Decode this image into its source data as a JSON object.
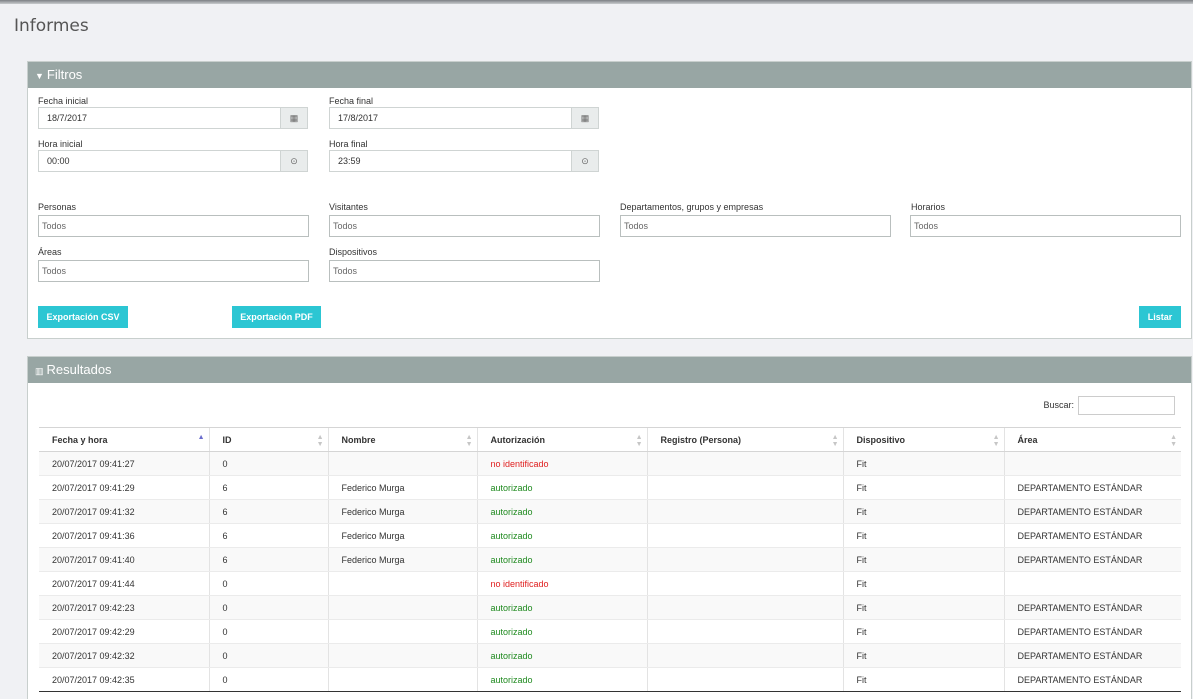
{
  "page": {
    "title": "Informes"
  },
  "filtros": {
    "header": "Filtros",
    "header_icon": "filter-icon",
    "fecha_inicial": {
      "label": "Fecha inicial",
      "value": "18/7/2017",
      "icon": "calendar-icon"
    },
    "fecha_final": {
      "label": "Fecha final",
      "value": "17/8/2017",
      "icon": "calendar-icon"
    },
    "hora_inicial": {
      "label": "Hora inicial",
      "value": "00:00",
      "icon": "clock-icon"
    },
    "hora_final": {
      "label": "Hora final",
      "value": "23:59",
      "icon": "clock-icon"
    },
    "personas": {
      "label": "Personas",
      "value": "Todos"
    },
    "visitantes": {
      "label": "Visitantes",
      "value": "Todos"
    },
    "departamentos": {
      "label": "Departamentos, grupos y empresas",
      "value": "Todos"
    },
    "horarios": {
      "label": "Horarios",
      "value": "Todos"
    },
    "areas": {
      "label": "Áreas",
      "value": "Todos"
    },
    "dispositivos": {
      "label": "Dispositivos",
      "value": "Todos"
    },
    "btn_csv": "Exportación CSV",
    "btn_pdf": "Exportación PDF",
    "btn_listar": "Listar",
    "button_color": "#2cc6d3"
  },
  "resultados": {
    "header": "Resultados",
    "header_icon": "bar-chart-icon",
    "search_label": "Buscar:",
    "columns": [
      "Fecha y hora",
      "ID",
      "Nombre",
      "Autorización",
      "Registro (Persona)",
      "Dispositivo",
      "Área"
    ],
    "rows": [
      [
        "20/07/2017 09:41:27",
        "0",
        "",
        "no identificado",
        "",
        "Fit",
        ""
      ],
      [
        "20/07/2017 09:41:29",
        "6",
        "Federico Murga",
        "autorizado",
        "",
        "Fit",
        "DEPARTAMENTO ESTÁNDAR"
      ],
      [
        "20/07/2017 09:41:32",
        "6",
        "Federico Murga",
        "autorizado",
        "",
        "Fit",
        "DEPARTAMENTO ESTÁNDAR"
      ],
      [
        "20/07/2017 09:41:36",
        "6",
        "Federico Murga",
        "autorizado",
        "",
        "Fit",
        "DEPARTAMENTO ESTÁNDAR"
      ],
      [
        "20/07/2017 09:41:40",
        "6",
        "Federico Murga",
        "autorizado",
        "",
        "Fit",
        "DEPARTAMENTO ESTÁNDAR"
      ],
      [
        "20/07/2017 09:41:44",
        "0",
        "",
        "no identificado",
        "",
        "Fit",
        ""
      ],
      [
        "20/07/2017 09:42:23",
        "0",
        "",
        "autorizado",
        "",
        "Fit",
        "DEPARTAMENTO ESTÁNDAR"
      ],
      [
        "20/07/2017 09:42:29",
        "0",
        "",
        "autorizado",
        "",
        "Fit",
        "DEPARTAMENTO ESTÁNDAR"
      ],
      [
        "20/07/2017 09:42:32",
        "0",
        "",
        "autorizado",
        "",
        "Fit",
        "DEPARTAMENTO ESTÁNDAR"
      ],
      [
        "20/07/2017 09:42:35",
        "0",
        "",
        "autorizado",
        "",
        "Fit",
        "DEPARTAMENTO ESTÁNDAR"
      ]
    ],
    "status_colors": {
      "autorizado": "#1f8a1f",
      "no identificado": "#e02020"
    }
  }
}
